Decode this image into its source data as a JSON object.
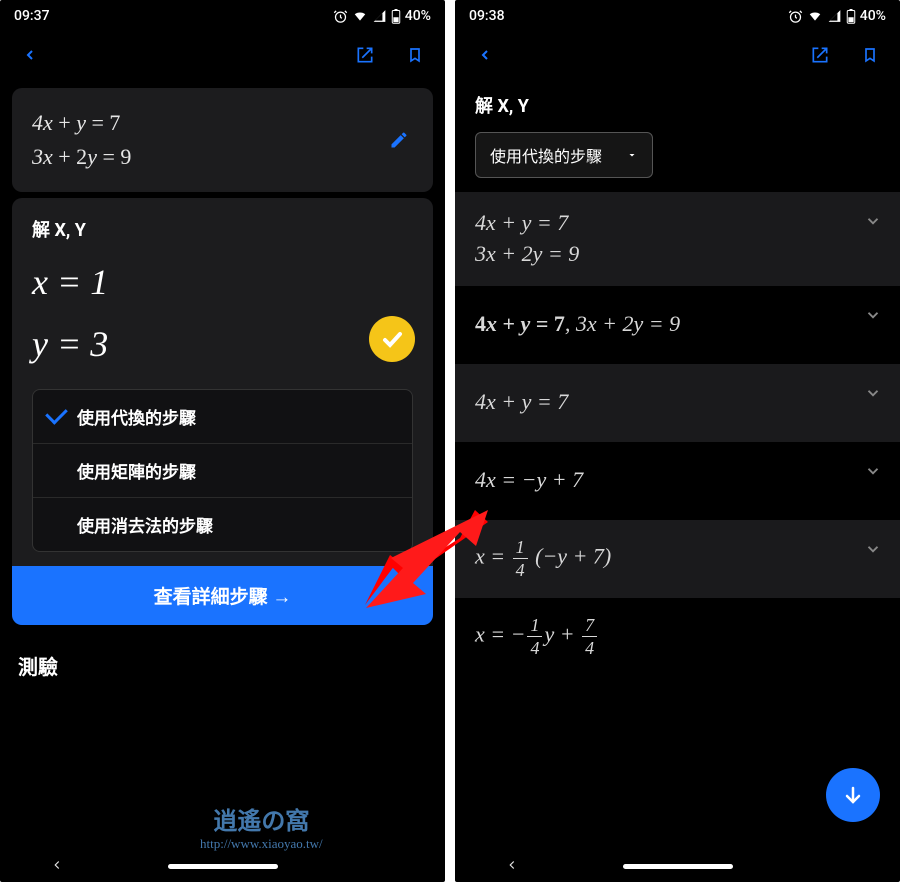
{
  "left": {
    "status": {
      "time": "09:37",
      "battery": "40%"
    },
    "problem": {
      "eq1": "4x + y = 7",
      "eq2": "3x + 2y = 9"
    },
    "solve": {
      "title": "解 X, Y",
      "result1": "x = 1",
      "result2": "y = 3"
    },
    "methods": {
      "opt1": "使用代換的步驟",
      "opt2": "使用矩陣的步驟",
      "opt3": "使用消去法的步驟"
    },
    "cta": "查看詳細步驟 →",
    "bottom_tab": "測驗"
  },
  "right": {
    "status": {
      "time": "09:38",
      "battery": "40%"
    },
    "title": "解 X, Y",
    "dropdown": "使用代換的步驟",
    "steps": {
      "s1a": "4x + y = 7",
      "s1b": "3x + 2y = 9",
      "s2": "4x + y = 7, 3x + 2y = 9",
      "s3": "4x + y = 7",
      "s4": "4x = −y + 7"
    }
  },
  "watermark": {
    "logo": "逍遙の窩",
    "url": "http://www.xiaoyao.tw/"
  }
}
